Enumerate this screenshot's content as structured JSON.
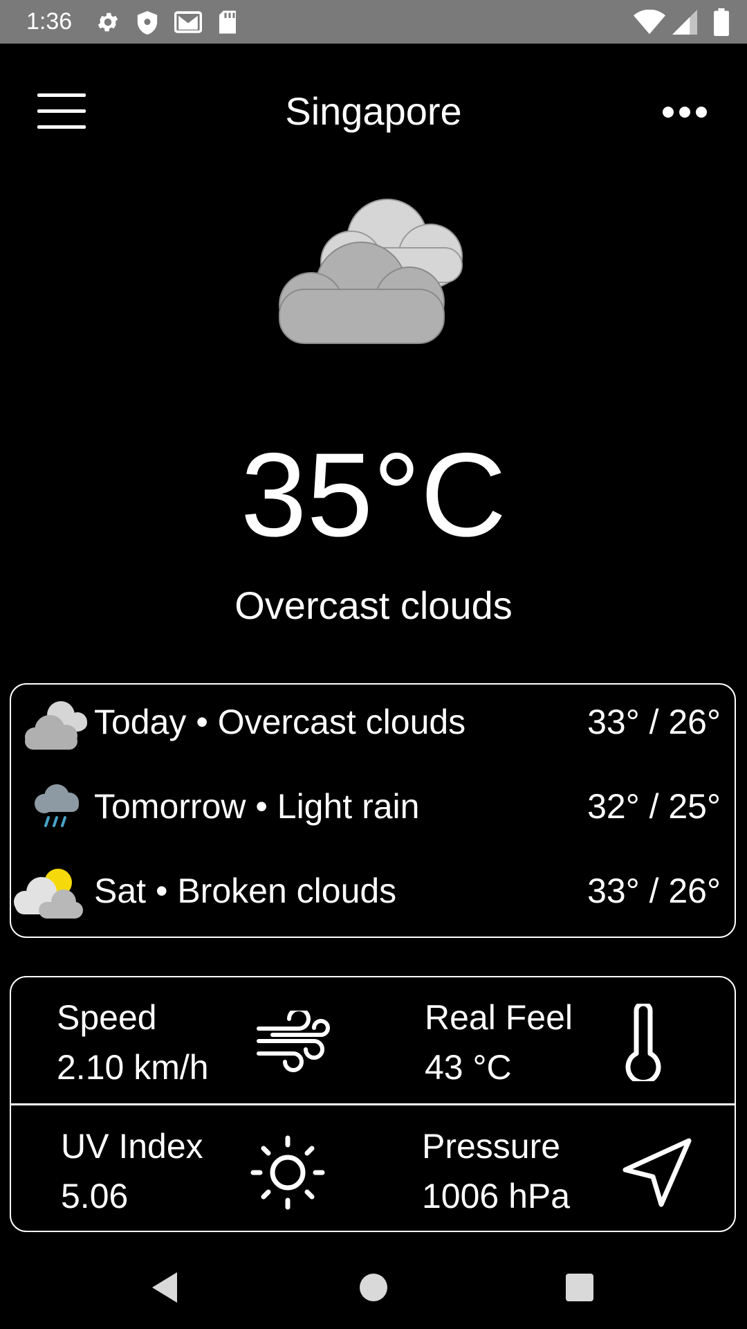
{
  "status_bar": {
    "time": "1:36",
    "left_icons": [
      "settings-icon",
      "shield-icon",
      "gmail-icon",
      "sd-card-icon"
    ],
    "right_icons": [
      "wifi-icon",
      "cell-signal-icon",
      "battery-icon"
    ]
  },
  "toolbar": {
    "city": "Singapore",
    "menu_icon": "hamburger-menu-icon",
    "more_icon": "more-horizontal-icon"
  },
  "current": {
    "icon": "overcast-clouds-icon",
    "temperature": "35°C",
    "description": "Overcast clouds"
  },
  "forecast": [
    {
      "text": "Today • Overcast clouds",
      "range": "33° / 26°",
      "icon": "overcast-clouds-icon"
    },
    {
      "text": "Tomorrow • Light rain",
      "range": "32° / 25°",
      "icon": "light-rain-icon"
    },
    {
      "text": "Sat • Broken clouds",
      "range": "33° / 26°",
      "icon": "broken-clouds-icon"
    }
  ],
  "details": {
    "speed": {
      "label": "Speed",
      "value": "2.10 km/h",
      "icon": "wind-icon"
    },
    "real_feel": {
      "label": "Real Feel",
      "value": "43 °C",
      "icon": "thermometer-icon"
    },
    "uv": {
      "label": "UV Index",
      "value": "5.06",
      "icon": "sun-icon"
    },
    "pressure": {
      "label": "Pressure",
      "value": "1006 hPa",
      "icon": "navigation-arrow-icon"
    }
  },
  "colors": {
    "background": "#000000",
    "status_bar": "#7a7a7a",
    "text": "#ffffff",
    "cloud_light": "#d6d6d6",
    "cloud_dark": "#b0b0b0",
    "sun": "#f5d90a",
    "rain": "#4aa3c7"
  }
}
